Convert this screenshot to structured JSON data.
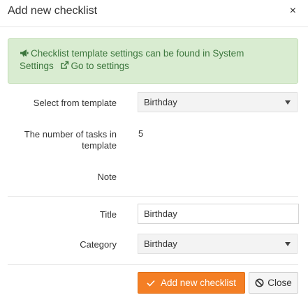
{
  "dialog": {
    "title": "Add new checklist",
    "close_glyph": "×"
  },
  "alert": {
    "line1": "Checklist template settings can be found in System",
    "line2": "Settings",
    "link": "Go to settings",
    "icon": "bullhorn-icon",
    "link_icon": "external-link-icon"
  },
  "form": {
    "template_label": "Select from template",
    "template_value": "Birthday",
    "tasks_label_line1": "The number of tasks in",
    "tasks_label_line2": "template",
    "tasks_value": "5",
    "note_label": "Note",
    "title_label": "Title",
    "title_value": "Birthday",
    "category_label": "Category",
    "category_value": "Birthday"
  },
  "buttons": {
    "add_label": "Add new checklist",
    "close_label": "Close"
  },
  "colors": {
    "primary": "#f47f25",
    "alert_bg": "#d9ecd1",
    "alert_text": "#3c763d"
  }
}
